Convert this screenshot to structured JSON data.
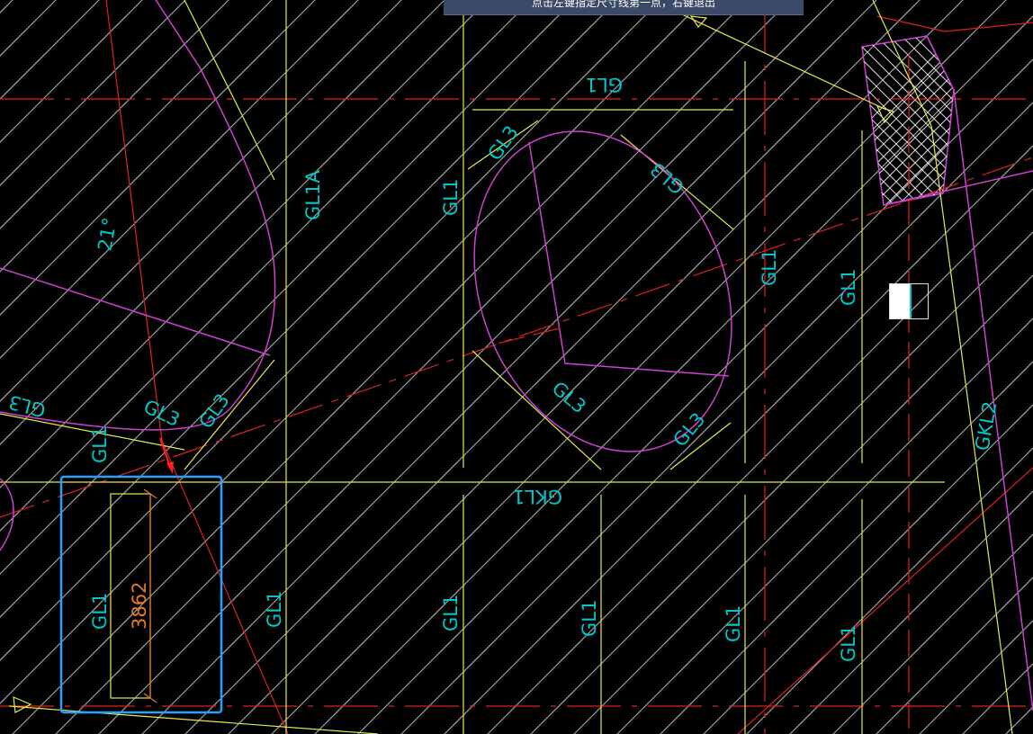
{
  "prompt": "点击左键指定尺寸线第一点，右键退出",
  "labels": {
    "gl1_top": "GL1",
    "gl1a": "GL1A",
    "gl1_mid_a": "GL1",
    "gl1_mid_b": "GL1",
    "gl1_mid_c": "GL1",
    "gl1_left": "GL1",
    "gl1_box": "GL1",
    "gl1_b1": "GL1",
    "gl1_b2": "GL1",
    "gl1_b3": "GL1",
    "gl1_b4": "GL1",
    "gl1_b5": "GL1",
    "gkl1": "GKL1",
    "gkl2": "GKL2",
    "gl3_1": "GL3",
    "gl3_2": "GL3",
    "gl3_3": "GL3",
    "gl3_4": "GL3",
    "gl3_5": "GL3",
    "gl3_6": "GL3",
    "gl3_7": "GL3",
    "angle": "21°",
    "dimension": "3862"
  },
  "colors": {
    "background": "#000000",
    "hatch": "#d8d8d8",
    "axis": "#e02020",
    "beam": "#e8e84a",
    "wall": "#d040d0",
    "text": "#00c8c8",
    "dimension": "#e07a2a",
    "selection": "#2aa0ff"
  }
}
